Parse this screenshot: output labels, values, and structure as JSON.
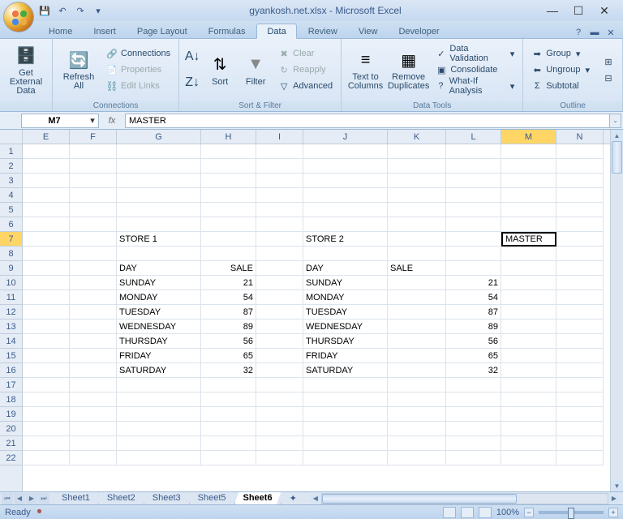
{
  "title": "gyankosh.net.xlsx - Microsoft Excel",
  "tabs": [
    "Home",
    "Insert",
    "Page Layout",
    "Formulas",
    "Data",
    "Review",
    "View",
    "Developer"
  ],
  "active_tab": 4,
  "ribbon": {
    "ext_data": {
      "get_external": "Get External\nData",
      "refresh": "Refresh\nAll",
      "connections": "Connections",
      "properties": "Properties",
      "edit_links": "Edit Links",
      "group_title": "Connections"
    },
    "sort_filter": {
      "sort": "Sort",
      "filter": "Filter",
      "clear": "Clear",
      "reapply": "Reapply",
      "advanced": "Advanced",
      "group_title": "Sort & Filter"
    },
    "data_tools": {
      "text_cols": "Text to\nColumns",
      "remove_dup": "Remove\nDuplicates",
      "validation": "Data Validation",
      "consolidate": "Consolidate",
      "whatif": "What-If Analysis",
      "group_title": "Data Tools"
    },
    "outline": {
      "group": "Group",
      "ungroup": "Ungroup",
      "subtotal": "Subtotal",
      "group_title": "Outline"
    }
  },
  "namebox": "M7",
  "formula": "MASTER",
  "columns": [
    {
      "id": "E",
      "w": 58
    },
    {
      "id": "F",
      "w": 58
    },
    {
      "id": "G",
      "w": 104
    },
    {
      "id": "H",
      "w": 68
    },
    {
      "id": "I",
      "w": 58
    },
    {
      "id": "J",
      "w": 104
    },
    {
      "id": "K",
      "w": 72
    },
    {
      "id": "L",
      "w": 68
    },
    {
      "id": "M",
      "w": 68
    },
    {
      "id": "N",
      "w": 58
    }
  ],
  "active_col": "M",
  "active_row": 7,
  "row_count": 22,
  "cells": {
    "7": {
      "G": "STORE 1",
      "J": "STORE 2",
      "M": "MASTER"
    },
    "9": {
      "G": "DAY",
      "H": "SALE",
      "J": "DAY",
      "K": "SALE"
    },
    "10": {
      "G": "SUNDAY",
      "H": "21",
      "J": "SUNDAY",
      "L": "21"
    },
    "11": {
      "G": "MONDAY",
      "H": "54",
      "J": "MONDAY",
      "L": "54"
    },
    "12": {
      "G": "TUESDAY",
      "H": "87",
      "J": "TUESDAY",
      "L": "87"
    },
    "13": {
      "G": "WEDNESDAY",
      "H": "89",
      "J": "WEDNESDAY",
      "L": "89"
    },
    "14": {
      "G": "THURSDAY",
      "H": "56",
      "J": "THURSDAY",
      "L": "56"
    },
    "15": {
      "G": "FRIDAY",
      "H": "65",
      "J": "FRIDAY",
      "L": "65"
    },
    "16": {
      "G": "SATURDAY",
      "H": "32",
      "J": "SATURDAY",
      "L": "32"
    }
  },
  "right_align_cols": [
    "H",
    "L"
  ],
  "sheets": [
    "Sheet1",
    "Sheet2",
    "Sheet3",
    "Sheet5",
    "Sheet6"
  ],
  "active_sheet": 4,
  "status": "Ready",
  "zoom": "100%"
}
